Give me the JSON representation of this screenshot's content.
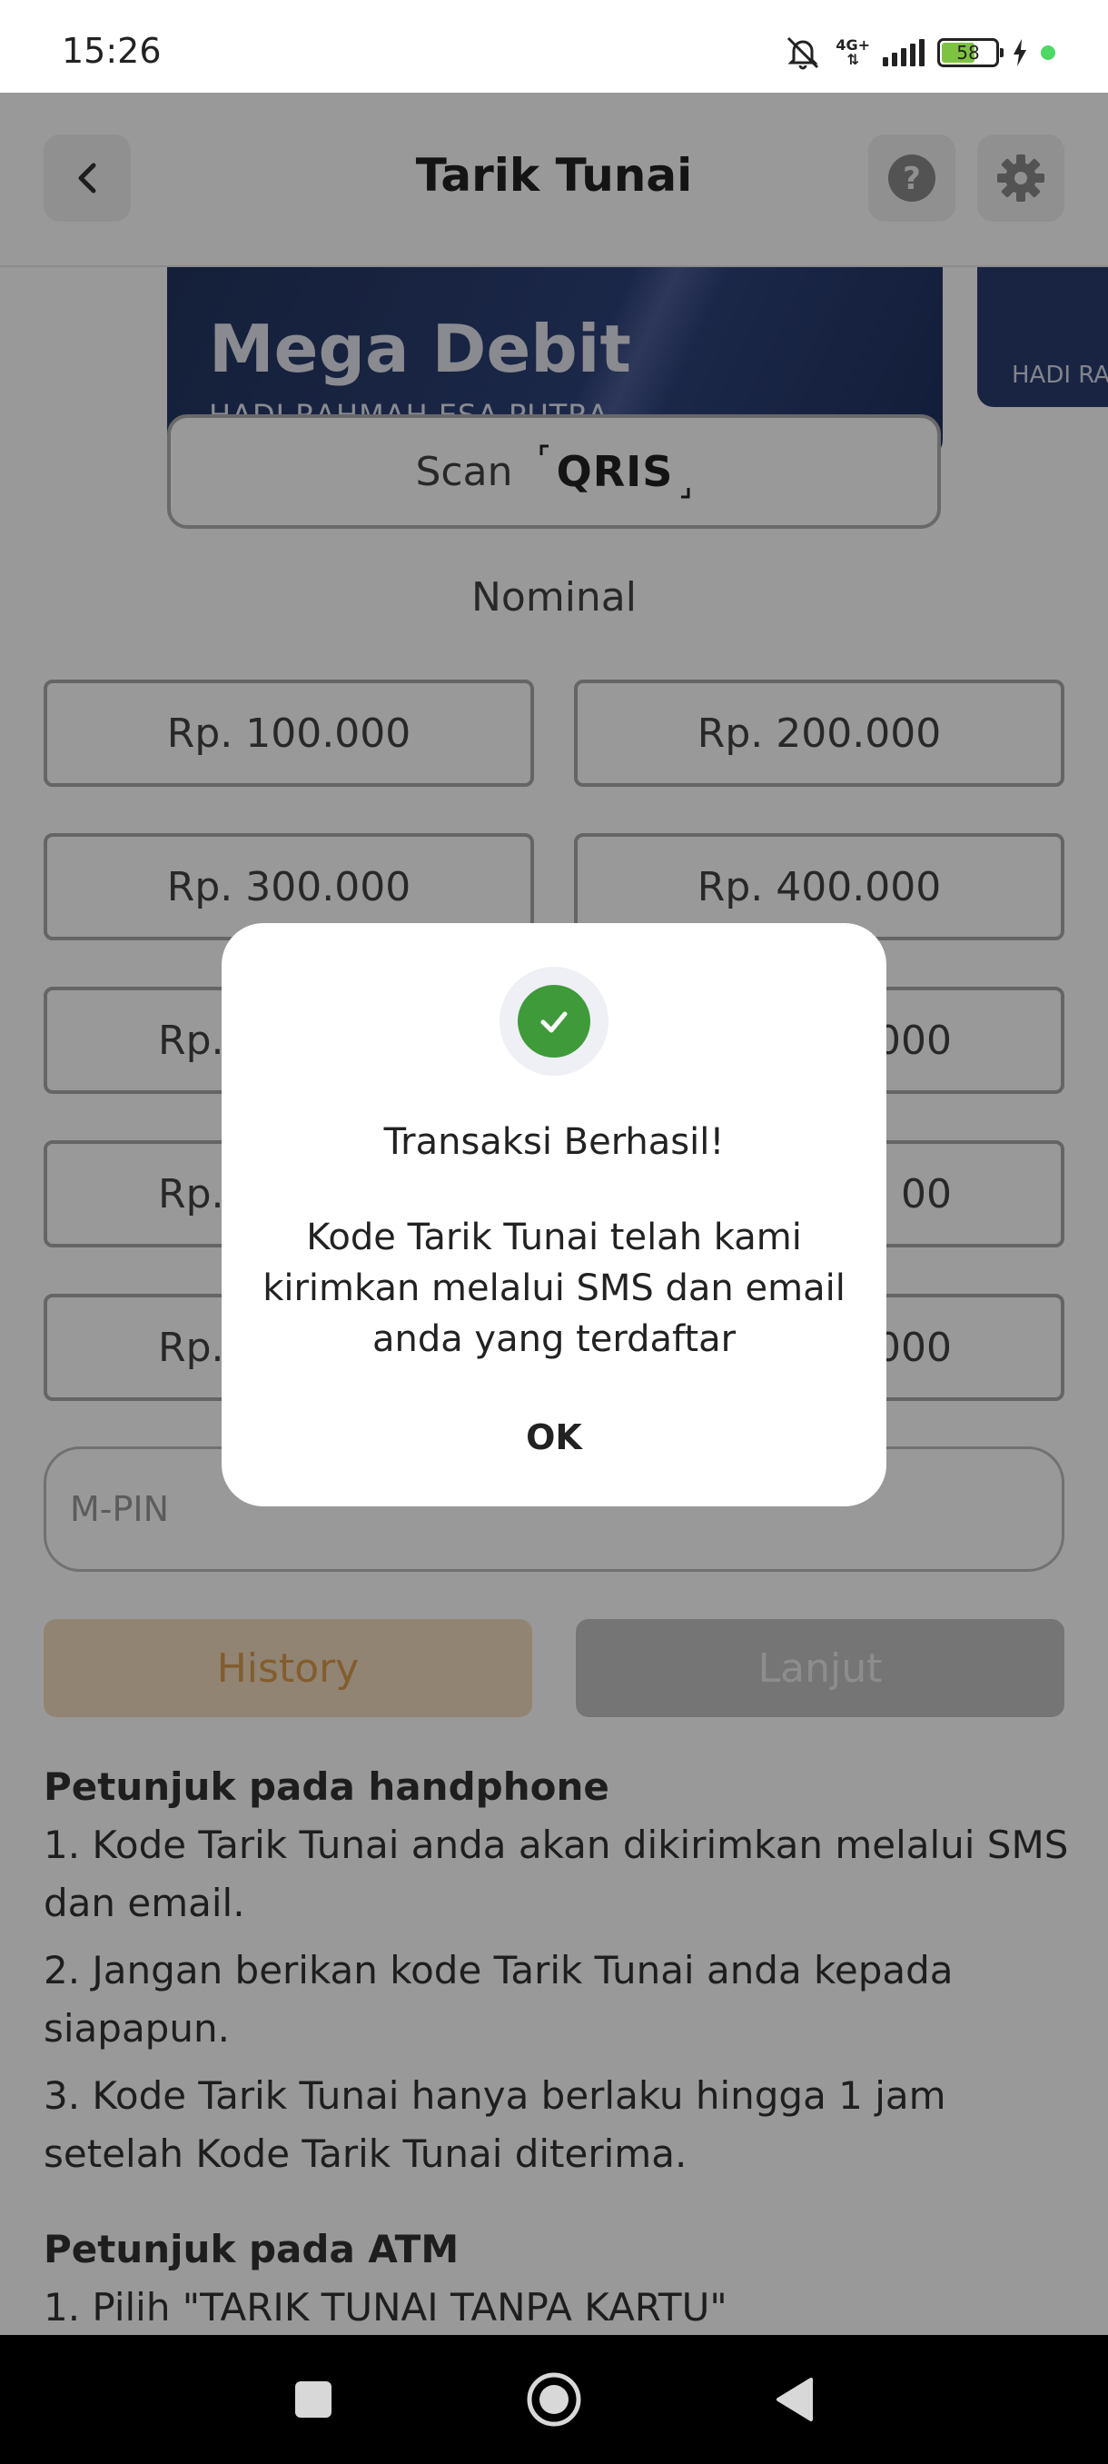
{
  "status_bar": {
    "time": "15:26",
    "network": "4G+",
    "battery": "58",
    "battery_level": 0.58
  },
  "header": {
    "title": "Tarik Tunai",
    "back_icon": "chevron-left-icon",
    "help_icon": "question-icon",
    "settings_icon": "gear-icon"
  },
  "cards": [
    {
      "brand": "Mega Debit",
      "holder": "HADI RAHMAH ESA PUTRA"
    },
    {
      "holder": "HADI RA"
    }
  ],
  "scan": {
    "label": "Scan",
    "logo": "QRIS"
  },
  "nominal": {
    "label": "Nominal",
    "options": [
      "Rp. 100.000",
      "Rp. 200.000",
      "Rp. 300.000",
      "Rp. 400.000",
      "Rp.",
      "000",
      "Rp.",
      "00",
      "Rp.",
      "000"
    ]
  },
  "mpin": {
    "placeholder": "M-PIN"
  },
  "actions": {
    "history": "History",
    "next": "Lanjut"
  },
  "instructions": {
    "phone_title": "Petunjuk pada handphone",
    "phone_steps": [
      "1. Kode Tarik Tunai anda akan dikirimkan melalui SMS dan email.",
      "2. Jangan berikan kode Tarik Tunai anda kepada siapapun.",
      "3. Kode Tarik Tunai hanya berlaku hingga 1 jam setelah Kode Tarik Tunai diterima."
    ],
    "atm_title": "Petunjuk pada ATM",
    "atm_first": "1. Pilih \"TARIK TUNAI TANPA KARTU\""
  },
  "dialog": {
    "title": "Transaksi Berhasil!",
    "message": "Kode Tarik Tunai telah kami kirimkan melalui SMS dan email anda yang terdaftar",
    "ok": "OK",
    "success_color": "#3f9a3a"
  },
  "colors": {
    "history_bg": "#f3dcc0",
    "history_text": "#d99b4e",
    "next_bg": "#c4c4c4",
    "card": "#2a3d70"
  }
}
